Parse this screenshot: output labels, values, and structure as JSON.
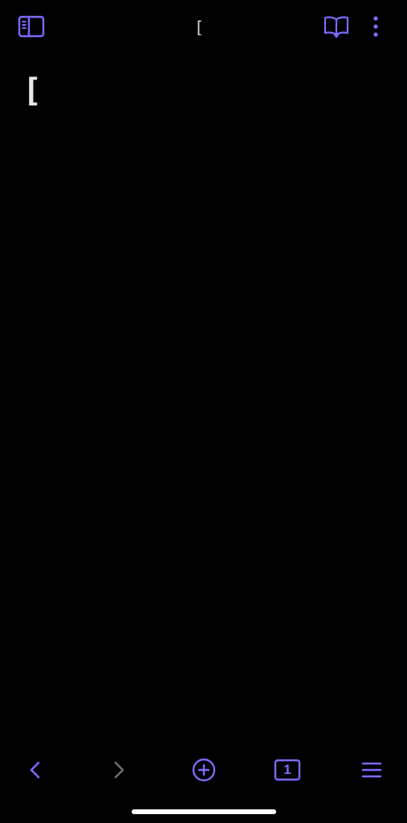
{
  "theme": {
    "background": "#000000",
    "accent": "#7a6cff",
    "text": "#e6e6e6",
    "disabled": "#6e6e73"
  },
  "header": {
    "title": "[",
    "left_icon": "sidebar-icon",
    "right_icons": [
      "reader-view-icon",
      "more-vertical-icon"
    ]
  },
  "content": {
    "text": "["
  },
  "toolbar": {
    "items": [
      "back-icon",
      "forward-icon",
      "new-tab-icon",
      "tabs-icon",
      "menu-icon"
    ],
    "tab_count": "1"
  }
}
